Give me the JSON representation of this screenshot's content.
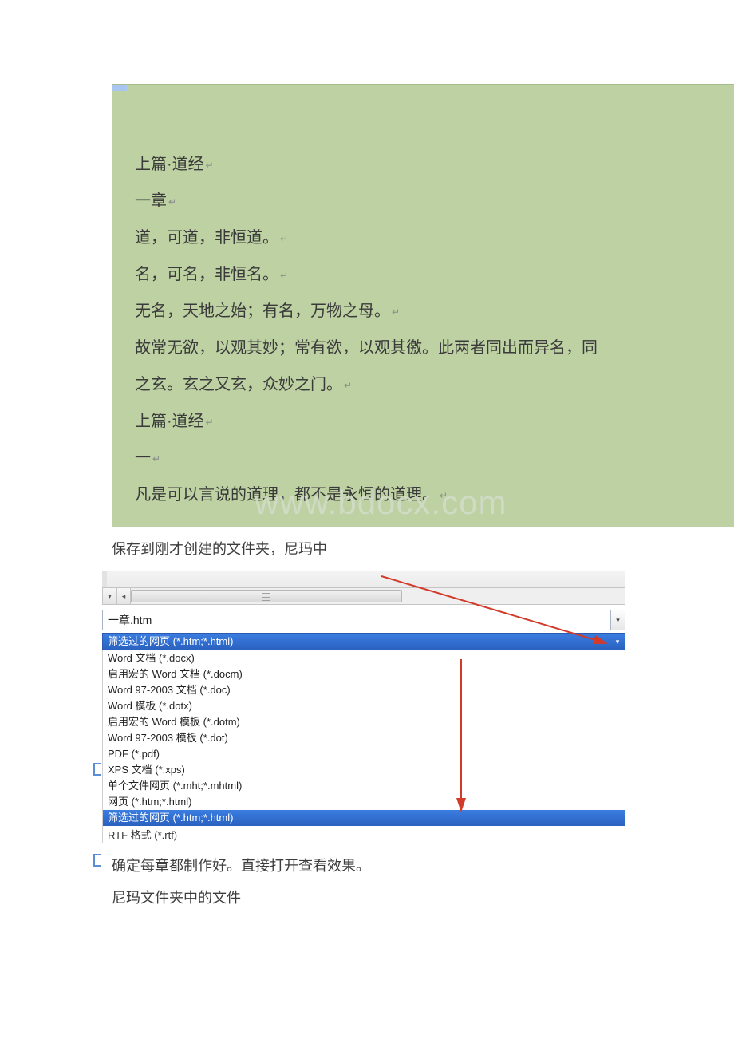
{
  "document": {
    "lines": [
      "上篇·道经",
      "一章",
      "道，可道，非恒道。",
      "名，可名，非恒名。",
      "无名，天地之始；有名，万物之母。",
      "故常无欲，以观其妙；常有欲，以观其徼。此两者同出而异名，同",
      "之玄。玄之又玄，众妙之门。",
      "上篇·道经",
      "一",
      "凡是可以言说的道理，都不是永恒的道理。"
    ],
    "watermark": "www.bdocx.com"
  },
  "captions": {
    "cap1": "保存到刚才创建的文件夹，尼玛中",
    "cap2": "确定每章都制作好。直接打开查看效果。",
    "cap3": "尼玛文件夹中的文件"
  },
  "save_dialog": {
    "filename": "一章.htm",
    "selected_type": "筛选过的网页 (*.htm;*.html)",
    "types": [
      "Word 文档 (*.docx)",
      "启用宏的 Word 文档 (*.docm)",
      "Word 97-2003 文档 (*.doc)",
      "Word 模板 (*.dotx)",
      "启用宏的 Word 模板 (*.dotm)",
      "Word 97-2003 模板 (*.dot)",
      "PDF (*.pdf)",
      "XPS 文档 (*.xps)",
      "单个文件网页 (*.mht;*.mhtml)",
      "网页 (*.htm;*.html)",
      "筛选过的网页 (*.htm;*.html)"
    ],
    "highlighted_index": 10,
    "below_item": "RTF 格式 (*.rtf)"
  }
}
